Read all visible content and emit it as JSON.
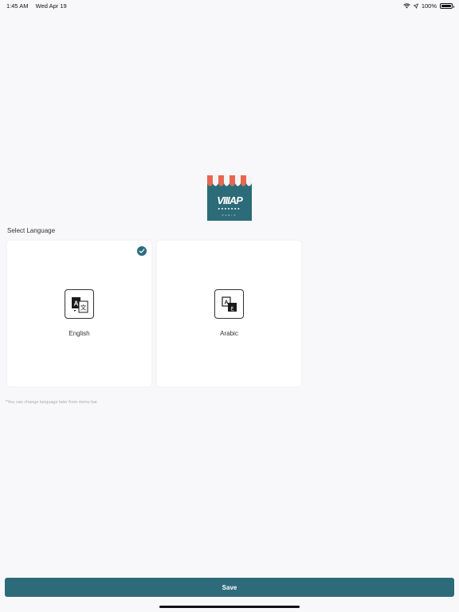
{
  "status_bar": {
    "time": "1:45 AM",
    "date": "Wed Apr 19",
    "battery": "100%"
  },
  "logo": {
    "word": "VIIIAP",
    "sub": "PARIS"
  },
  "language": {
    "section_label": "Select Language",
    "options": [
      {
        "label": "English",
        "selected": true
      },
      {
        "label": "Arabic",
        "selected": false
      }
    ],
    "note": "*You can change language later from menu bar"
  },
  "footer": {
    "save_label": "Save"
  },
  "colors": {
    "accent": "#2d6b7a",
    "background": "#f8f8fa"
  }
}
